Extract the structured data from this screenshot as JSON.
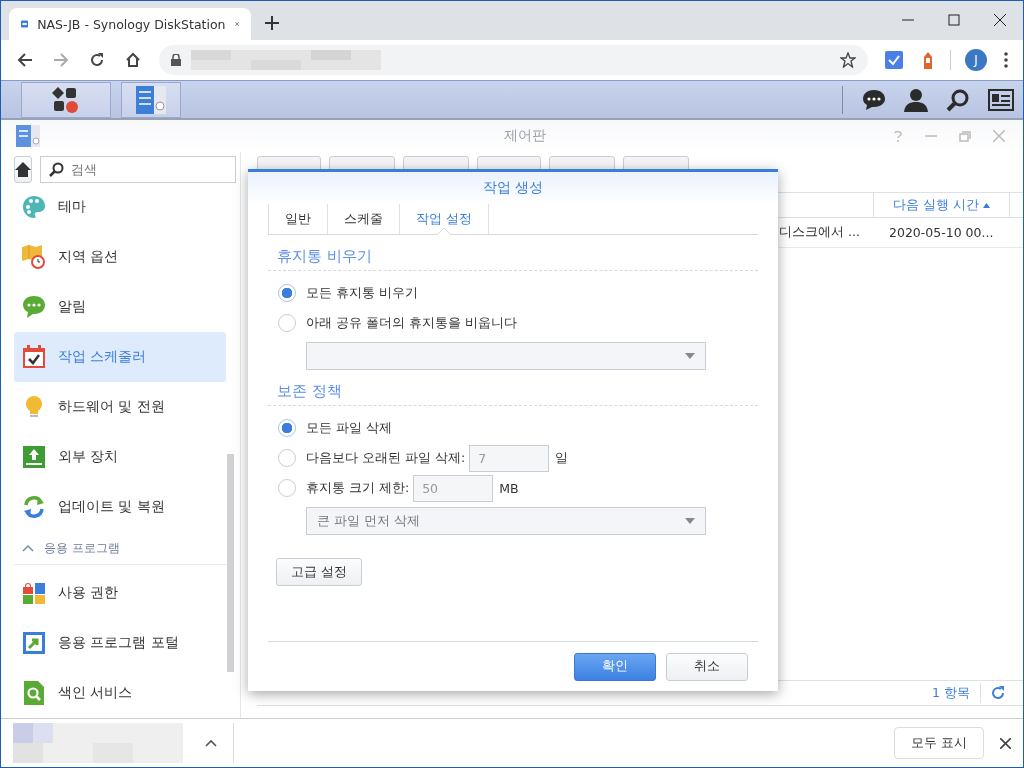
{
  "browser": {
    "tab_title": "NAS-JB - Synology DiskStation",
    "profile_initial": "J"
  },
  "control_panel": {
    "title": "제어판",
    "search": {
      "placeholder": "검색"
    },
    "sidebar": [
      {
        "kind": "item",
        "label": "테마",
        "selected": false
      },
      {
        "kind": "item",
        "label": "지역 옵션",
        "selected": false
      },
      {
        "kind": "item",
        "label": "알림",
        "selected": false
      },
      {
        "kind": "item",
        "label": "작업 스케줄러",
        "selected": true
      },
      {
        "kind": "item",
        "label": "하드웨어 및 전원",
        "selected": false
      },
      {
        "kind": "item",
        "label": "외부 장치",
        "selected": false
      },
      {
        "kind": "item",
        "label": "업데이트 및 복원",
        "selected": false
      },
      {
        "kind": "section",
        "label": "응용 프로그램",
        "expanded": true
      },
      {
        "kind": "item",
        "label": "사용 권한",
        "selected": false
      },
      {
        "kind": "item",
        "label": "응용 프로그램 포털",
        "selected": false
      },
      {
        "kind": "item",
        "label": "색인 서비스",
        "selected": false
      }
    ],
    "table": {
      "columns": [
        {
          "label": "다음 실행 시간",
          "sorted_ascending": true
        }
      ],
      "rows": [
        {
          "column_2": "디스크에서 ...",
          "next_run": "2020-05-10 00..."
        }
      ],
      "footer_count": "1 항목"
    }
  },
  "dialog": {
    "title": "작업 생성",
    "tabs": [
      {
        "label": "일반",
        "selected": false
      },
      {
        "label": "스케줄",
        "selected": false
      },
      {
        "label": "작업 설정",
        "selected": true
      }
    ],
    "sections": [
      {
        "title": "휴지통 비우기",
        "options": [
          {
            "kind": "plain",
            "label": "모든 휴지통 비우기",
            "selected": true
          },
          {
            "kind": "plain",
            "label": "아래 공유 폴더의 휴지통을 비웁니다",
            "selected": false
          }
        ],
        "dropdown": {
          "disabled": true
        }
      },
      {
        "title": "보존 정책",
        "options": [
          {
            "kind": "plain",
            "label": "모든 파일 삭제",
            "selected": true
          },
          {
            "kind": "field",
            "label": "다음보다 오래된 파일 삭제:",
            "value": "7",
            "unit": "일",
            "disabled": true,
            "selected": false
          },
          {
            "kind": "field",
            "label": "휴지통 크기 제한:",
            "value": "50",
            "unit": "MB",
            "disabled": true,
            "selected": false
          }
        ],
        "dropdown": {
          "value": "큰 파일 먼저 삭제",
          "disabled": true
        }
      }
    ],
    "advanced_button": "고급 설정",
    "buttons": [
      {
        "label": "확인",
        "kind": "primary"
      },
      {
        "label": "취소",
        "kind": "secondary"
      }
    ]
  },
  "download_bar": {
    "show_all": "모두 표시"
  }
}
